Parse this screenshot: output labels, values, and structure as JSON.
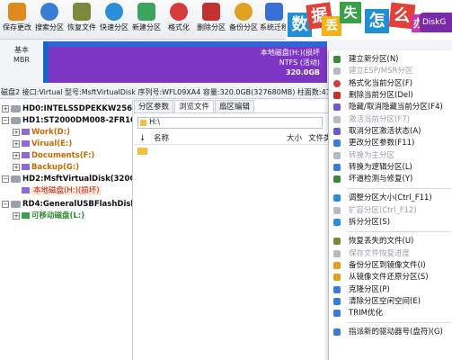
{
  "toolbar": {
    "buttons": [
      {
        "label": "保存更改",
        "icon": "save-icon",
        "color": "#e08a1e"
      },
      {
        "label": "搜索分区",
        "icon": "search-icon",
        "color": "#3a7bd5"
      },
      {
        "label": "恢复文件",
        "icon": "recover-file-icon",
        "color": "#7a8a3a"
      },
      {
        "label": "快速分区",
        "icon": "quick-partition-icon",
        "color": "#2a8fd8"
      },
      {
        "label": "新建分区",
        "icon": "new-partition-icon",
        "color": "#3ba55c"
      },
      {
        "label": "格式化",
        "icon": "format-icon",
        "color": "#d63a3a"
      },
      {
        "label": "删除分区",
        "icon": "delete-partition-icon",
        "color": "#c23030"
      },
      {
        "label": "备份分区",
        "icon": "backup-partition-icon",
        "color": "#e0a020"
      },
      {
        "label": "系统迁移",
        "icon": "system-migrate-icon",
        "color": "#3a6fd8"
      }
    ],
    "banner": {
      "chars": [
        "数",
        "据",
        "丢",
        "失",
        "怎",
        "么",
        "办"
      ],
      "tile_colors": [
        "#1f8fd6",
        "#e2413a",
        "#f2b21a",
        "#3aa04a",
        "#1f8fd6",
        "#e2413a",
        "#c43bb0"
      ],
      "brand": "DiskG"
    }
  },
  "diskmap": {
    "basic": "基本",
    "mbr": "MBR",
    "partition": {
      "name": "本地磁盘(H:)(损坏",
      "fs": "NTFS (活动)",
      "size": "320.0GB"
    }
  },
  "status_line": "磁盘2 接口:Virtual  型号:MsftVirtualDisk  序列号:WFL09XA4  容量:320.0GB(327680MB)  柱面数:41773",
  "tree": {
    "hd0": "HD0:INTELSSDPEKKW256G8",
    "hd1": "HD1:ST2000DM008-2FR102(18",
    "hd1_parts": [
      "Work(D:)",
      "Virual(E:)",
      "Documents(F:)",
      "Backup(G:)"
    ],
    "hd2": "HD2:MsftVirtualDisk(320GB)",
    "hd2_part": "本地磁盘(H:)(损坏)",
    "rd4": "RD4:GeneralUSBFlashDisk(4G",
    "rd4_part": "可移动磁盘(L:)"
  },
  "browser": {
    "tabs": [
      "分区参数",
      "浏览文件",
      "扇区编辑"
    ],
    "path": "H:\\",
    "col_name": "名称",
    "col_size": "大小",
    "col_type": "文件类"
  },
  "menu": {
    "items": [
      {
        "label": "建立新分区(N)",
        "disabled": false,
        "icon_color": "#3a8a3a"
      },
      {
        "label": "建立ESP/MSR分区",
        "disabled": true,
        "icon_color": "#b6bcc4"
      },
      {
        "label": "格式化当前分区(F)",
        "disabled": false,
        "icon_color": "#d63a3a"
      },
      {
        "label": "删除当前分区(Del)",
        "disabled": false,
        "icon_color": "#c23030"
      },
      {
        "label": "隐藏/取消隐藏当前分区(F4)",
        "disabled": false,
        "icon_color": "#6d5ad0"
      },
      {
        "label": "激活当前分区(F7)",
        "disabled": true,
        "icon_color": "#b6bcc4"
      },
      {
        "label": "取消分区激活状态(A)",
        "disabled": false,
        "icon_color": "#6d5ad0"
      },
      {
        "label": "更改分区参数(F11)",
        "disabled": false,
        "icon_color": "#3a7bd5"
      },
      {
        "label": "转换为主分区",
        "disabled": true,
        "icon_color": "#b6bcc4"
      },
      {
        "label": "转换为逻辑分区(L)",
        "disabled": false,
        "icon_color": "#3a7bd5"
      },
      {
        "label": "坏道检测与修复(Y)",
        "disabled": false,
        "icon_color": "#3a8a3a"
      },
      {
        "label": "调整分区大小(Ctrl_F11)",
        "disabled": false,
        "icon_color": "#2a8fd8"
      },
      {
        "label": "扩容分区(Ctrl_F12)",
        "disabled": true,
        "icon_color": "#b6bcc4"
      },
      {
        "label": "拆分分区(S)",
        "disabled": false,
        "icon_color": "#2a8fd8"
      },
      {
        "label": "恢复丢失的文件(U)",
        "disabled": false,
        "icon_color": "#7a8a3a"
      },
      {
        "label": "保存文件恢复进度",
        "disabled": true,
        "icon_color": "#b6bcc4"
      },
      {
        "label": "备份分区到镜像文件(I)",
        "disabled": false,
        "icon_color": "#e0a020"
      },
      {
        "label": "从镜像文件还原分区(S)",
        "disabled": false,
        "icon_color": "#e0a020"
      },
      {
        "label": "克隆分区(P)",
        "disabled": false,
        "icon_color": "#3a7bd5"
      },
      {
        "label": "清除分区空闲空间(E)",
        "disabled": false,
        "icon_color": "#3a7bd5"
      },
      {
        "label": "TRIM优化",
        "disabled": false,
        "icon_color": "#3a7bd5"
      },
      {
        "label": "指派新的驱动器号(盘符)(G)",
        "disabled": false,
        "icon_color": "#3a7bd5"
      }
    ]
  }
}
